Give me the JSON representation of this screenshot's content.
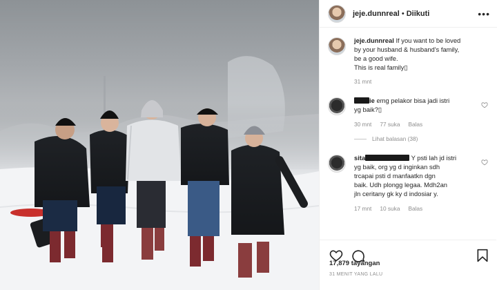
{
  "post": {
    "username": "jeje.dunnreal",
    "separator": "•",
    "follow_status": "Diikuti",
    "more_label": "•••",
    "caption_lines": [
      "If you want to be loved",
      "by your husband & husband's family,",
      "be a good wife.",
      "This is real family▯"
    ],
    "caption_time": "31 mnt"
  },
  "comments": [
    {
      "username_visible": "ie",
      "text_first": "emg pelakor bisa jadi istri",
      "text_rest": "yg baik?▯",
      "time": "30 mnt",
      "likes": "77 suka",
      "reply_label": "Balas",
      "view_replies": "Lihat balasan (38)"
    },
    {
      "username_visible": "sita",
      "text_first": "Y psti lah jd istri",
      "text_lines": [
        "yg baik, org yg d inginkan sdh",
        "trcapai psti d manfaatkn dgn",
        "baik. Udh plongg legaa. Mdh2an",
        "jln ceritany gk ky d indosiar y."
      ],
      "time": "17 mnt",
      "likes": "10 suka",
      "reply_label": "Balas"
    }
  ],
  "stats": {
    "views": "17,879 tayangan",
    "posted_ago": "31 MENIT YANG LALU"
  },
  "icons": [
    "ellipsis-icon",
    "heart-icon",
    "comment-icon",
    "bookmark-icon"
  ]
}
